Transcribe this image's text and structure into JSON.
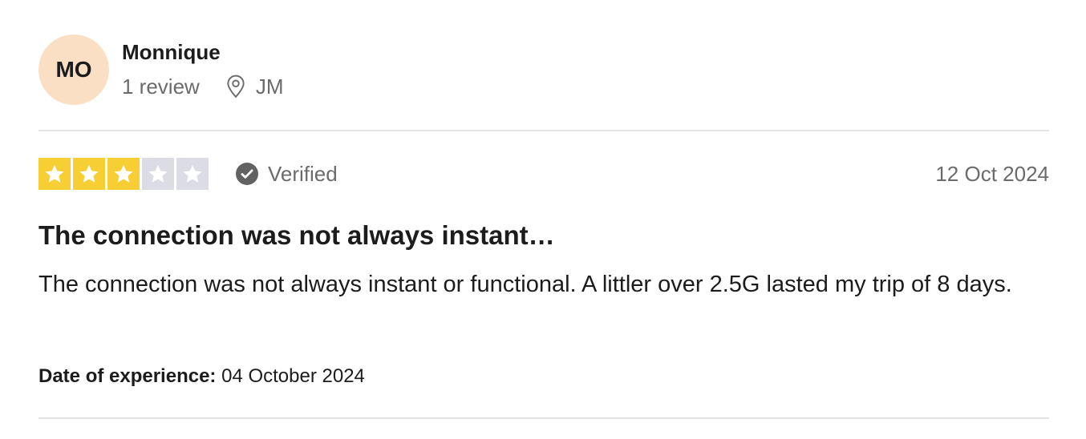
{
  "reviewer": {
    "initials": "MO",
    "name": "Monnique",
    "review_count": "1 review",
    "location": "JM",
    "avatar_color": "#fbdfc5"
  },
  "review": {
    "rating": 3,
    "max_rating": 5,
    "star_color_filled": "#f7cf35",
    "star_color_empty": "#dcdce6",
    "verified_label": "Verified",
    "date": "12 Oct 2024",
    "title": "The connection was not always instant…",
    "body": "The connection was not always instant or functional. A littler over 2.5G lasted my trip of 8 days.",
    "experience_label": "Date of experience:",
    "experience_date": "04 October 2024"
  },
  "icons": {
    "location": "map-pin-icon",
    "verified": "check-circle-icon",
    "star": "star-icon"
  }
}
